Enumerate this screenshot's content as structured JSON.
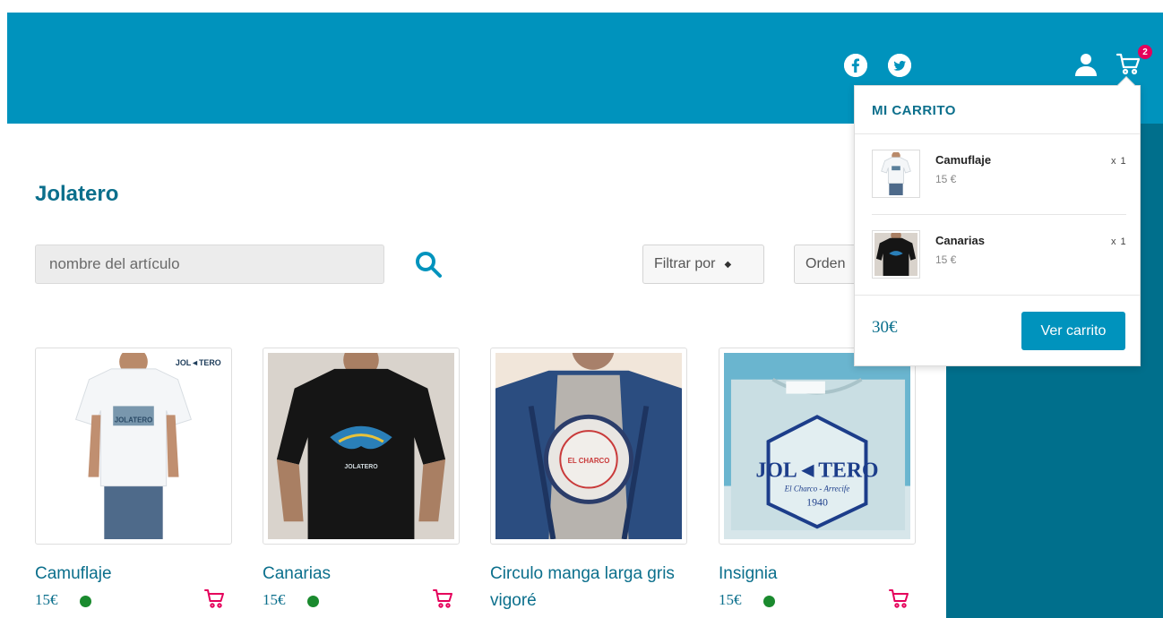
{
  "colors": {
    "brand": "#0093bd",
    "text_accent": "#0b6f8c",
    "cart_accent": "#e5005b",
    "in_stock": "#1a8a2e",
    "panel": "#006f8c"
  },
  "header": {
    "social": [
      "facebook-icon",
      "twitter-icon"
    ],
    "user_icon": "user-icon",
    "cart_icon": "cart-icon",
    "cart_count": "2"
  },
  "page": {
    "title": "Jolatero",
    "search": {
      "placeholder": "nombre del artículo"
    },
    "filter_label": "Filtrar por",
    "sort_label": "Orden"
  },
  "products": [
    {
      "name": "Camuflaje",
      "price": "15€",
      "shirt_color": "#f4f6f8",
      "in_stock": true
    },
    {
      "name": "Canarias",
      "price": "15€",
      "shirt_color": "#151515",
      "in_stock": true
    },
    {
      "name": "Circulo manga larga gris vigoré",
      "price": "",
      "shirt_color": "#b7b3ae",
      "in_stock": true
    },
    {
      "name": "Insignia",
      "price": "15€",
      "shirt_color": "#c9dee3",
      "in_stock": true
    }
  ],
  "mini_cart": {
    "title": "MI CARRITO",
    "items": [
      {
        "name": "Camuflaje",
        "price": "15 €",
        "qty": "x 1"
      },
      {
        "name": "Canarias",
        "price": "15 €",
        "qty": "x 1"
      }
    ],
    "total": "30€",
    "button_label": "Ver carrito"
  },
  "logo_text": {
    "brand": "JOL◄TERO",
    "place": "El Charco - Arrecife",
    "year": "1940"
  }
}
